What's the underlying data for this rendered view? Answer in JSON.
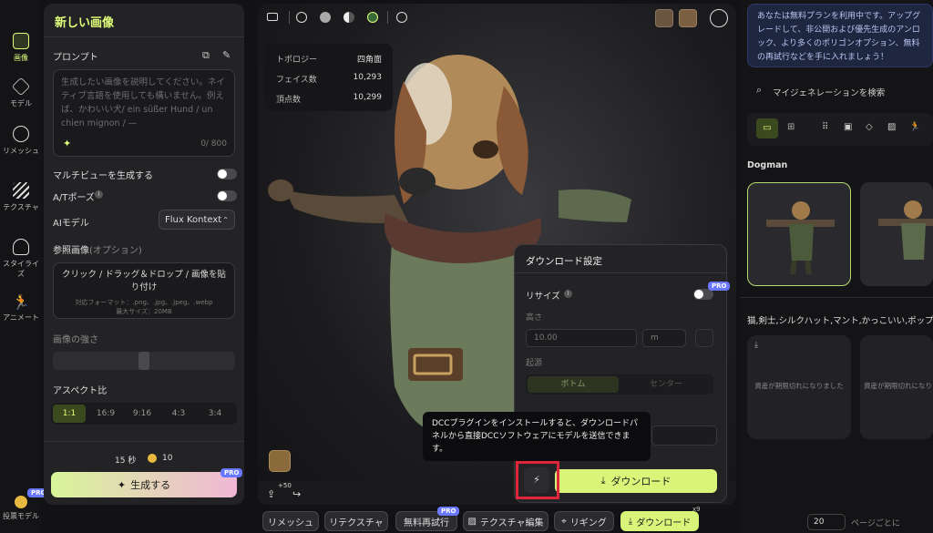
{
  "rail": {
    "items": [
      {
        "label": "画像",
        "icon": "image-ai-icon"
      },
      {
        "label": "モデル",
        "icon": "cube-icon"
      },
      {
        "label": "リメッシュ",
        "icon": "remesh-icon"
      },
      {
        "label": "テクスチャ",
        "icon": "texture-icon"
      },
      {
        "label": "スタイライズ",
        "icon": "stylize-icon"
      },
      {
        "label": "アニメート",
        "icon": "running-icon"
      }
    ],
    "bottom_label": "投票モデル",
    "bottom_badge": "PRO"
  },
  "left": {
    "title": "新しい画像",
    "prompt_label": "プロンプト",
    "prompt_placeholder": "生成したい画像を説明してください。ネイティブ言語を使用しても構いません。例えば、かわいい犬/ ein süßer Hund / un chien mignon / —",
    "prompt_count": "0/ 800",
    "multiview_label": "マルチビューを生成する",
    "atpose_label": "A/Tポーズ",
    "ai_model_label": "AIモデル",
    "ai_model_value": "Flux Kontext",
    "ref_label": "参照画像",
    "ref_optional": "(オプション)",
    "upload_text": "クリック / ドラッグ＆ドロップ / 画像を貼り付け",
    "upload_formats": "対応フォーマット：.png、.jpg、.jpeg、.webp",
    "upload_maxsize": "最大サイズ：20MB",
    "strength_label": "画像の強さ",
    "aspect_label": "アスペクト比",
    "aspect_options": [
      "1:1",
      "16:9",
      "9:16",
      "4:3",
      "3:4"
    ],
    "aspect_selected": "1:1",
    "time_cost": "15 秒",
    "credit_cost": "10",
    "generate_label": "生成する",
    "generate_badge": "PRO"
  },
  "viewport": {
    "stats": [
      {
        "k": "トポロジー",
        "v": "四角面"
      },
      {
        "k": "フェイス数",
        "v": "10,293"
      },
      {
        "k": "頂点数",
        "v": "10,299"
      }
    ],
    "plus_badge": "+50"
  },
  "download_panel": {
    "title": "ダウンロード設定",
    "resize_label": "リサイズ",
    "resize_badge": "PRO",
    "height_label": "高さ",
    "height_value": "10.00",
    "unit_value": "m",
    "origin_label": "起源",
    "origin_bottom": "ボトム",
    "origin_center": "センター",
    "download_label": "ダウンロード"
  },
  "tooltip": {
    "text": "DCCプラグインをインストールすると、ダウンロードパネルから直接DCCソフトウェアにモデルを送信できます。"
  },
  "bottom_toolbar": {
    "remesh": "リメッシュ",
    "retexture": "リテクスチャ",
    "free_retry": "無料再試行",
    "free_retry_badge": "PRO",
    "texture_edit": "テクスチャ編集",
    "rigging": "リギング",
    "download": "ダウンロード",
    "download_badge": "x9"
  },
  "right": {
    "notice": "あなたは無料プランを利用中です。アップグレードして、非公開および優先生成のアンロック、より多くのポリゴンオプション、無料の再試行などを手に入れましょう！",
    "search_placeholder": "マイジェネレーションを検索",
    "group1_title": "Dogman",
    "group2_title": "猫,剣士,シルクハット,マント,かっこいい,ポップ",
    "expired_text_1": "資産が期限切れになりました",
    "expired_text_2": "資産が期限切れになりました",
    "page_size": "20",
    "per_page": "ページごとに"
  },
  "colors": {
    "accent": "#e0ff7a",
    "pro": "#6a78ff",
    "highlight": "#e0263a"
  }
}
